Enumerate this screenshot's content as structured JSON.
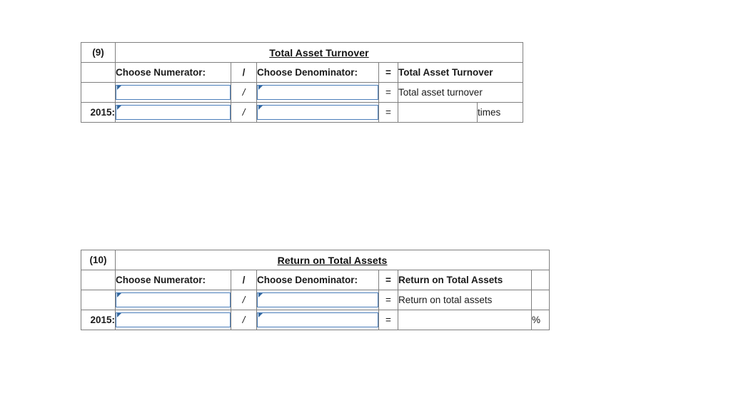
{
  "page": {
    "background_color": "#ffffff",
    "header_blue": "#7cabdd",
    "input_border_blue": "#4a7ebb",
    "grid_line_color": "#7f7f7f"
  },
  "tables": [
    {
      "index_label": "(9)",
      "title": "Total Asset Turnover",
      "column_headers": {
        "numerator": "Choose Numerator:",
        "slash": "/",
        "denominator": "Choose Denominator:",
        "equals": "=",
        "result": "Total Asset Turnover",
        "unit": ""
      },
      "rows": [
        {
          "row_label": "",
          "numerator_value": "",
          "numerator_placeholder": "",
          "slash": "/",
          "denominator_value": "",
          "denominator_placeholder": "",
          "equals": "=",
          "result_value": "Total asset turnover",
          "unit": ""
        },
        {
          "row_label": "2015:",
          "numerator_value": "",
          "numerator_placeholder": "",
          "slash": "/",
          "denominator_value": "",
          "denominator_placeholder": "",
          "equals": "=",
          "result_value": "",
          "unit": "times"
        }
      ]
    },
    {
      "index_label": "(10)",
      "title": "Return on Total Assets",
      "column_headers": {
        "numerator": "Choose Numerator:",
        "slash": "/",
        "denominator": "Choose Denominator:",
        "equals": "=",
        "result": "Return on Total Assets",
        "unit": ""
      },
      "rows": [
        {
          "row_label": "",
          "numerator_value": "",
          "numerator_placeholder": "",
          "slash": "/",
          "denominator_value": "",
          "denominator_placeholder": "",
          "equals": "=",
          "result_value": "Return on total assets",
          "unit": ""
        },
        {
          "row_label": "2015:",
          "numerator_value": "",
          "numerator_placeholder": "",
          "slash": "/",
          "denominator_value": "",
          "denominator_placeholder": "",
          "equals": "=",
          "result_value": "",
          "unit": "%"
        }
      ]
    }
  ]
}
